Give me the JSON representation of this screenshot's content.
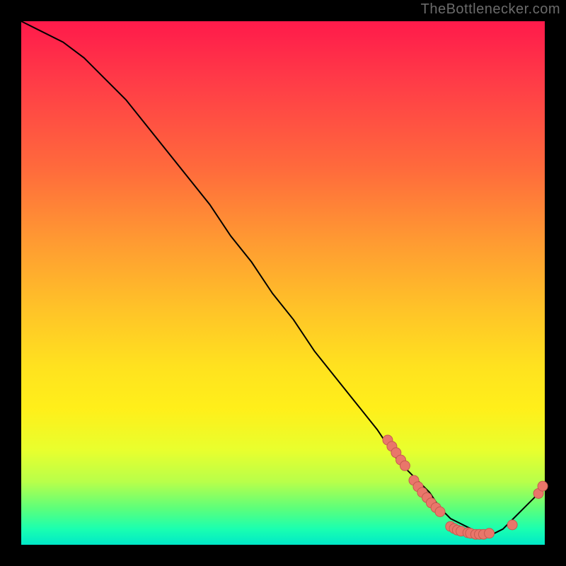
{
  "watermark": "TheBottlenecker.com",
  "chart_data": {
    "type": "line",
    "title": "",
    "xlabel": "",
    "ylabel": "",
    "xlim": [
      0,
      100
    ],
    "ylim": [
      0,
      100
    ],
    "grid": false,
    "series": [
      {
        "name": "curve",
        "x": [
          0,
          4,
          8,
          12,
          16,
          20,
          24,
          28,
          32,
          36,
          40,
          44,
          48,
          52,
          56,
          60,
          64,
          68,
          72,
          74,
          76,
          78,
          80,
          82,
          84,
          86,
          88,
          90,
          92,
          94,
          96,
          98,
          100
        ],
        "y": [
          100,
          98,
          96,
          93,
          89,
          85,
          80,
          75,
          70,
          65,
          59,
          54,
          48,
          43,
          37,
          32,
          27,
          22,
          16,
          14,
          12,
          10,
          7,
          5,
          4,
          3,
          2,
          2,
          3,
          5,
          7,
          9,
          12
        ]
      }
    ],
    "markers": [
      {
        "x": 70.0,
        "y": 20.0
      },
      {
        "x": 70.8,
        "y": 18.8
      },
      {
        "x": 71.6,
        "y": 17.6
      },
      {
        "x": 72.5,
        "y": 16.2
      },
      {
        "x": 73.3,
        "y": 15.1
      },
      {
        "x": 75.0,
        "y": 12.3
      },
      {
        "x": 75.8,
        "y": 11.1
      },
      {
        "x": 76.6,
        "y": 10.0
      },
      {
        "x": 77.5,
        "y": 9.0
      },
      {
        "x": 78.3,
        "y": 8.0
      },
      {
        "x": 79.2,
        "y": 7.1
      },
      {
        "x": 80.0,
        "y": 6.3
      },
      {
        "x": 82.0,
        "y": 3.5
      },
      {
        "x": 82.7,
        "y": 3.1
      },
      {
        "x": 83.3,
        "y": 2.8
      },
      {
        "x": 84.0,
        "y": 2.6
      },
      {
        "x": 85.3,
        "y": 2.3
      },
      {
        "x": 85.8,
        "y": 2.2
      },
      {
        "x": 86.8,
        "y": 2.0
      },
      {
        "x": 87.5,
        "y": 2.0
      },
      {
        "x": 88.3,
        "y": 2.0
      },
      {
        "x": 89.4,
        "y": 2.2
      },
      {
        "x": 93.8,
        "y": 3.8
      },
      {
        "x": 98.8,
        "y": 9.8
      },
      {
        "x": 99.6,
        "y": 11.2
      }
    ],
    "gradient_stops": [
      {
        "pos": 0.0,
        "color": "#ff1a4b"
      },
      {
        "pos": 0.12,
        "color": "#ff3d47"
      },
      {
        "pos": 0.28,
        "color": "#ff6a3c"
      },
      {
        "pos": 0.42,
        "color": "#ff9a32"
      },
      {
        "pos": 0.55,
        "color": "#ffc328"
      },
      {
        "pos": 0.66,
        "color": "#ffe21f"
      },
      {
        "pos": 0.74,
        "color": "#ffef1a"
      },
      {
        "pos": 0.82,
        "color": "#e8ff2e"
      },
      {
        "pos": 0.88,
        "color": "#b8ff4a"
      },
      {
        "pos": 0.93,
        "color": "#5dff7a"
      },
      {
        "pos": 0.97,
        "color": "#1affb0"
      },
      {
        "pos": 1.0,
        "color": "#00e8c8"
      }
    ],
    "colors": {
      "line": "#000000",
      "marker_fill": "#e9766a",
      "marker_stroke": "#c65a50",
      "frame": "#000000"
    }
  }
}
